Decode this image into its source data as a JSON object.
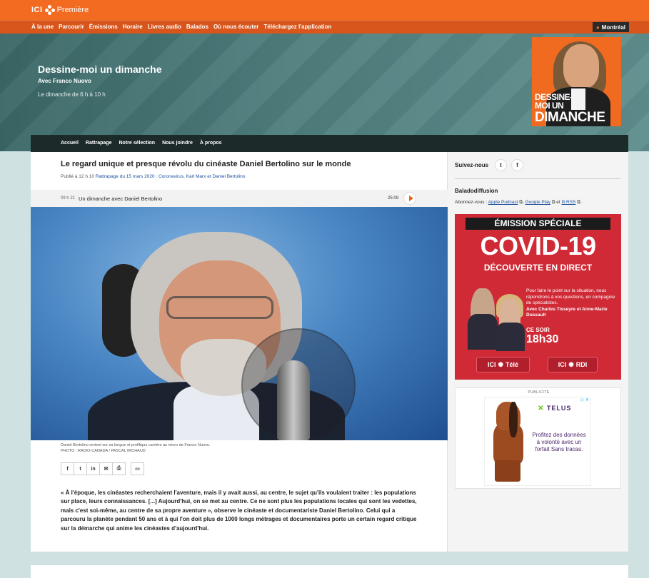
{
  "brand": {
    "ici": "ICI",
    "premiere": "Première"
  },
  "nav": {
    "items": [
      "À la une",
      "Parcourir",
      "Émissions",
      "Horaire",
      "Livres audio",
      "Balados",
      "Où nous écouter",
      "Téléchargez l'application"
    ],
    "city": "Montréal"
  },
  "show": {
    "title": "Dessine-moi un dimanche",
    "host": "Avec Franco Nuovo",
    "time": "Le dimanche de 6 h à 10 h",
    "cover_line1": "DESSINE-",
    "cover_line2": "MOI UN",
    "cover_line3": "DIMANCHE"
  },
  "submenu": {
    "items": [
      "Accueil",
      "Rattrapage",
      "Notre sélection",
      "Nous joindre",
      "À propos"
    ]
  },
  "article": {
    "title": "Le regard unique et presque révolu du cinéaste Daniel Bertolino sur le monde",
    "published": "Publié à 12 h 10",
    "meta_link": "Rattrapage du 15 mars 2020 : Coronavirus, Karl Marx et Daniel Bertolino",
    "audio_time": "09 h 21",
    "audio_title": "Un dimanche avec Daniel Bertolino",
    "audio_duration": "25:09",
    "caption": "Daniel Bertolino revient sur sa longue et prolifique carrière au micro de Franco Nuovo.",
    "credit": "PHOTO : RADIO-CANADA / PASCAL MICHAUD",
    "body": "« À l'époque, les cinéastes recherchaient l'aventure, mais il y avait aussi, au centre, le sujet qu'ils voulaient traiter : les populations sur place, leurs connaissances. [...] Aujourd'hui, on se met au centre. Ce ne sont plus les populations locales qui sont les vedettes, mais c'est soi-même, au centre de sa propre aventure », observe le cinéaste et documentariste Daniel Bertolino. Celui qui a parcouru la planète pendant 50 ans et à qui l'on doit plus de 1000 longs métrages et documentaires porte un certain regard critique sur la démarche qui anime les cinéastes d'aujourd'hui."
  },
  "share": {
    "facebook": "f",
    "twitter": "t",
    "linkedin": "in",
    "email": "✉",
    "print": "⎙",
    "comment": "▭"
  },
  "sidebar": {
    "follow": "Suivez-nous",
    "twitter": "t",
    "facebook": "f",
    "podcast_title": "Baladodiffusion",
    "subscribe": "Abonnez-vous :",
    "apple": "Apple Podcast",
    "google": "Google Play",
    "and": "et",
    "rss": "fil RSS"
  },
  "covid_ad": {
    "banner": "ÉMISSION SPÉCIALE",
    "big": "COVID-19",
    "live": "DÉCOUVERTE EN DIRECT",
    "desc": "Pour faire le point sur la situation, nous répondrons à vos questions, en compagnie de spécialistes.",
    "hosts": "Avec Charles Tisseyre et Anne-Marie Dussault",
    "ce_soir": "CE SOIR",
    "hour": "18h30",
    "ch1_ici": "ICI",
    "ch1": "Télé",
    "ch2_ici": "ICI",
    "ch2": "RDI"
  },
  "ad": {
    "label": "PUBLICITÉ",
    "brand": "TELUS",
    "message": "Profitez des données à volonté avec un forfait Sans tracas.",
    "adchoices": "▷ ✕"
  },
  "colors": {
    "orange": "#f36b21",
    "dark_teal": "#1d2a2a",
    "covid_red": "#cf2a36",
    "telus_purple": "#4b286d"
  }
}
